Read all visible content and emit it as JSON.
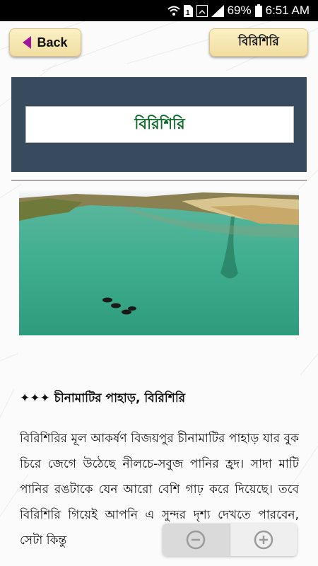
{
  "status_bar": {
    "battery": "69%",
    "time": "6:51 AM"
  },
  "toolbar": {
    "back_label": "Back",
    "title_label": "বিরিশিরি"
  },
  "header": {
    "title": "বিরিশিরি"
  },
  "article": {
    "heading": "✦✦✦ চীনামাটির পাহাড়, বিরিশিরি",
    "body": "বিরিশিরির মূল আকর্ষণ বিজয়পুর চীনামাটির পাহাড় যার বুক চিরে জেগে উঠেছে নীলচে-সবুজ পানির হ্রদ। সাদা মাটি পানির রঙটাকে যেন আরো বেশি গাঢ় করে দিয়েছে। তবে বিরিশিরি গিয়েই আপনি এ সুন্দর দৃশ্য দেখতে পারবেন, সেটা কিন্তু"
  },
  "colors": {
    "header_panel": "#374a5e",
    "header_title": "#0f6b2a",
    "button_bg": "#f1dda0",
    "back_arrow": "#a0149c"
  },
  "icons": {
    "wifi": "wifi-icon",
    "sim": "sim-icon",
    "signal": "signal-icon",
    "battery": "battery-icon",
    "zoom_out": "zoom-out-icon",
    "zoom_in": "zoom-in-icon"
  }
}
